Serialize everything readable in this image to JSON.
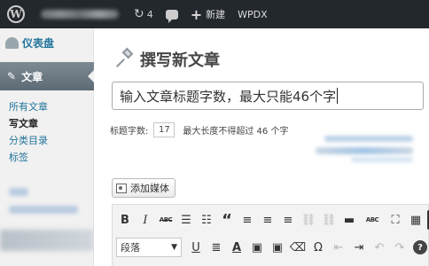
{
  "adminbar": {
    "logo_glyph": "W",
    "comments_count": "4",
    "new_label": "新建",
    "extra_label": "WPDX",
    "icons": [
      "wordpress-logo-icon",
      "updates-icon",
      "comments-bubble-icon",
      "plus-icon"
    ]
  },
  "sidebar": {
    "dashboard_label": "仪表盘",
    "posts_label": "文章",
    "submenu": [
      {
        "label": "所有文章",
        "current": false
      },
      {
        "label": "写文章",
        "current": true
      },
      {
        "label": "分类目录",
        "current": false
      },
      {
        "label": "标签",
        "current": false
      }
    ]
  },
  "main": {
    "page_title": "撰写新文章",
    "title_input_value": "输入文章标题字数，最大只能46个字",
    "title_count_label": "标题字数:",
    "title_count_value": "17",
    "title_count_hint": "最大长度不得超过 46 个字",
    "add_media_label": "添加媒体"
  },
  "toolbar": {
    "row1": [
      "B",
      "I",
      "ABC",
      "☰",
      "☷",
      "“",
      "≡",
      "≡",
      "≡",
      "⛓",
      "⛓",
      "▬",
      "ABC",
      "⛶",
      "▦",
      "S"
    ],
    "format_select_value": "段落",
    "row2": [
      "U",
      "≣",
      "A",
      "▣",
      "▣",
      "⌫",
      "Ω",
      "⇤",
      "⇥",
      "↶",
      "↷",
      "?"
    ]
  },
  "colors": {
    "adminbar_bg": "#23282d",
    "link_blue": "#21759b",
    "active_menu": "#5e6b75"
  }
}
